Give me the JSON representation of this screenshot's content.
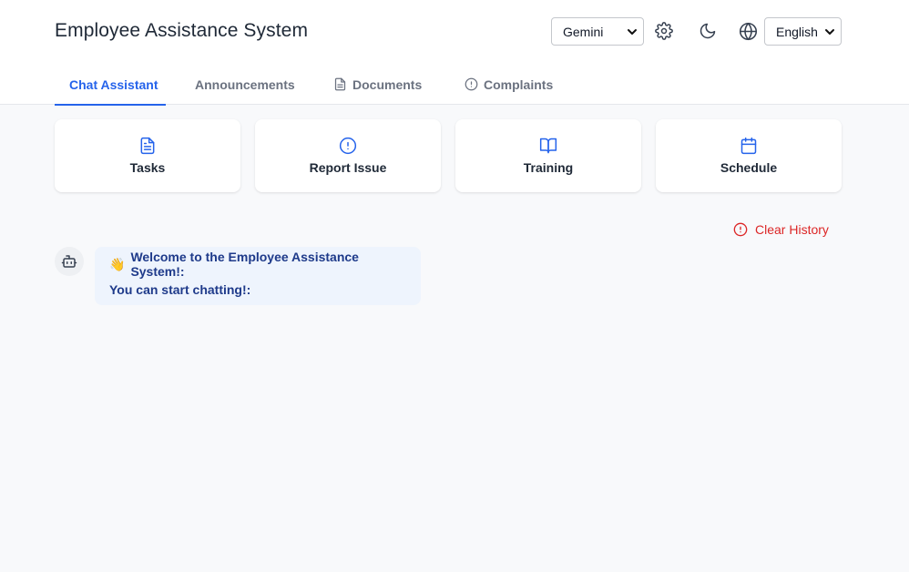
{
  "header": {
    "title": "Employee Assistance System",
    "model_select": {
      "value": "Gemini"
    },
    "language_select": {
      "value": "English"
    },
    "icons": {
      "settings": "gear-icon",
      "theme": "moon-icon",
      "language": "globe-icon"
    }
  },
  "tabs": [
    {
      "label": "Chat Assistant",
      "active": true
    },
    {
      "label": "Announcements",
      "icon": ""
    },
    {
      "label": "Documents",
      "icon": "document-icon"
    },
    {
      "label": "Complaints",
      "icon": "alert-circle-icon"
    }
  ],
  "quick_actions": [
    {
      "label": "Tasks",
      "icon": "document-icon"
    },
    {
      "label": "Report Issue",
      "icon": "alert-circle-icon"
    },
    {
      "label": "Training",
      "icon": "book-icon"
    },
    {
      "label": "Schedule",
      "icon": "calendar-icon"
    }
  ],
  "chat": {
    "clear_history_label": "Clear History",
    "messages": [
      {
        "sender": "bot",
        "emoji": "👋",
        "line1": "Welcome to the Employee Assistance System!:",
        "line2": "You can start chatting!:"
      }
    ]
  },
  "colors": {
    "accent": "#2563eb",
    "danger": "#dc2626",
    "bubble_bg": "#eef4fd",
    "bubble_text": "#1e3a8a",
    "background": "#f8f9fb"
  }
}
